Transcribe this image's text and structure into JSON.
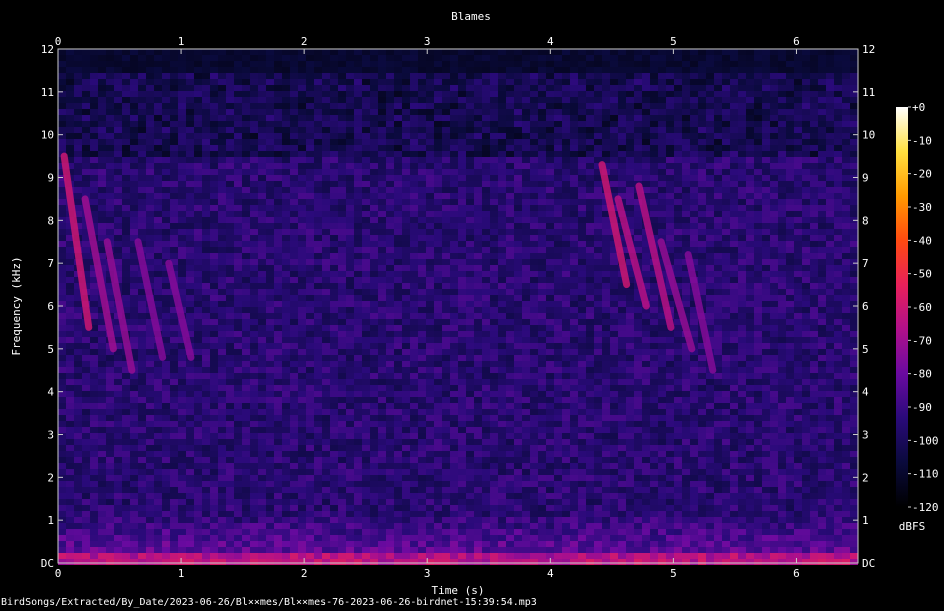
{
  "chart_data": {
    "type": "heatmap",
    "title": "Blames",
    "xlabel": "Time (s)",
    "ylabel": "Frequency (kHz)",
    "xlim": [
      0,
      6.5
    ],
    "ylim": [
      0,
      12
    ],
    "x_ticks": [
      "0",
      "1",
      "2",
      "3",
      "4",
      "5",
      "6"
    ],
    "y_ticks": [
      "DC",
      "1",
      "2",
      "3",
      "4",
      "5",
      "6",
      "7",
      "8",
      "9",
      "10",
      "11",
      "12"
    ],
    "colorbar": {
      "label": "dBFS",
      "range": [
        -120,
        0
      ],
      "ticks": [
        "+0",
        "-10",
        "-20",
        "-30",
        "-40",
        "-50",
        "-60",
        "-70",
        "-80",
        "-90",
        "-100",
        "-110",
        "-120"
      ],
      "colormap": [
        "#000000",
        "#0a0a3c",
        "#2a0a7a",
        "#6a0aa0",
        "#b0108a",
        "#e8205a",
        "#ff4a10",
        "#ff9a00",
        "#ffe040",
        "#ffffff"
      ]
    },
    "background_level_dbfs": -95,
    "noise_ceiling_khz": 11.5,
    "calls": [
      {
        "t_start": 0.05,
        "t_end": 0.25,
        "f_high": 9.5,
        "f_low": 5.5,
        "level_dbfs": -60
      },
      {
        "t_start": 0.22,
        "t_end": 0.45,
        "f_high": 8.5,
        "f_low": 5.0,
        "level_dbfs": -70
      },
      {
        "t_start": 0.4,
        "t_end": 0.6,
        "f_high": 7.5,
        "f_low": 4.5,
        "level_dbfs": -72
      },
      {
        "t_start": 0.65,
        "t_end": 0.85,
        "f_high": 7.5,
        "f_low": 4.8,
        "level_dbfs": -75
      },
      {
        "t_start": 0.9,
        "t_end": 1.08,
        "f_high": 7.0,
        "f_low": 4.8,
        "level_dbfs": -75
      },
      {
        "t_start": 4.42,
        "t_end": 4.62,
        "f_high": 9.3,
        "f_low": 6.5,
        "level_dbfs": -60
      },
      {
        "t_start": 4.55,
        "t_end": 4.78,
        "f_high": 8.5,
        "f_low": 6.0,
        "level_dbfs": -65
      },
      {
        "t_start": 4.72,
        "t_end": 4.98,
        "f_high": 8.8,
        "f_low": 5.5,
        "level_dbfs": -65
      },
      {
        "t_start": 4.9,
        "t_end": 5.15,
        "f_high": 7.5,
        "f_low": 5.0,
        "level_dbfs": -72
      },
      {
        "t_start": 5.12,
        "t_end": 5.32,
        "f_high": 7.2,
        "f_low": 4.5,
        "level_dbfs": -75
      }
    ]
  },
  "footer": {
    "path": "BirdSongs/Extracted/By_Date/2023-06-26/Bl××mes/Bl××mes-76-2023-06-26-birdnet-15:39:54.mp3"
  }
}
